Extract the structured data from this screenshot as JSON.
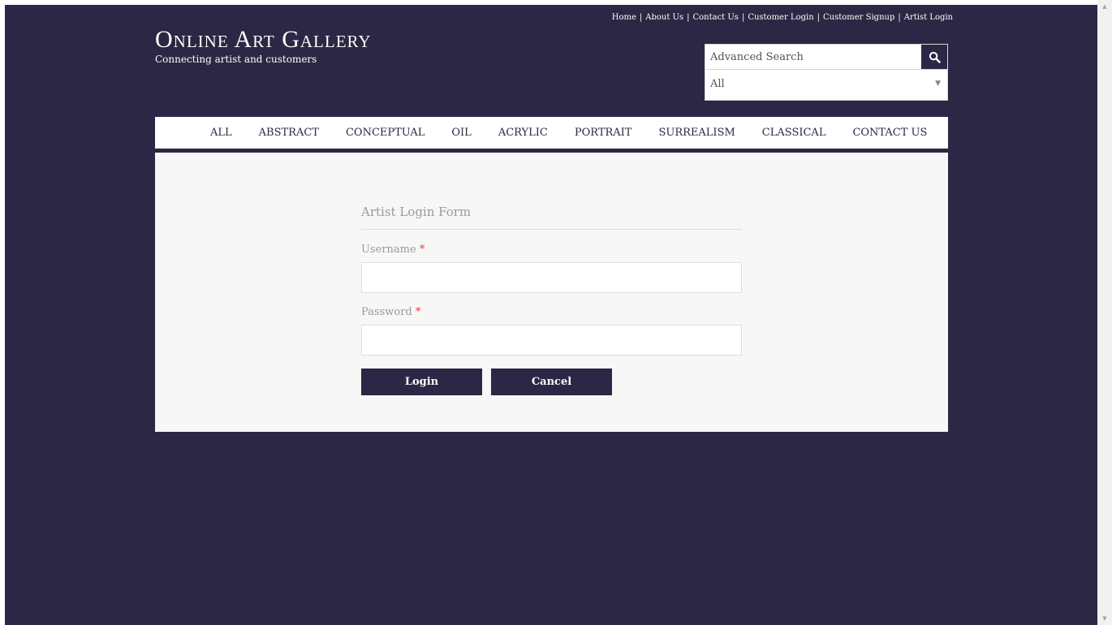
{
  "header": {
    "top_links": [
      "Home",
      "About Us",
      "Contact Us",
      "Customer Login",
      "Customer Signup",
      "Artist Login"
    ],
    "site_title": "Online Art Gallery",
    "tagline": "Connecting artist and customers"
  },
  "search": {
    "placeholder": "Advanced Search",
    "icon": "search-icon",
    "category_selected": "All"
  },
  "nav": {
    "items": [
      "ALL",
      "ABSTRACT",
      "CONCEPTUAL",
      "OIL",
      "ACRYLIC",
      "PORTRAIT",
      "SURREALISM",
      "CLASSICAL",
      "CONTACT US"
    ]
  },
  "form": {
    "title": "Artist Login Form",
    "username_label": "Username",
    "password_label": "Password",
    "required_mark": "*",
    "login_label": "Login",
    "cancel_label": "Cancel"
  },
  "colors": {
    "primary": "#2b2744",
    "panel_bg": "#f7f7f7",
    "required": "#e33b3b"
  }
}
